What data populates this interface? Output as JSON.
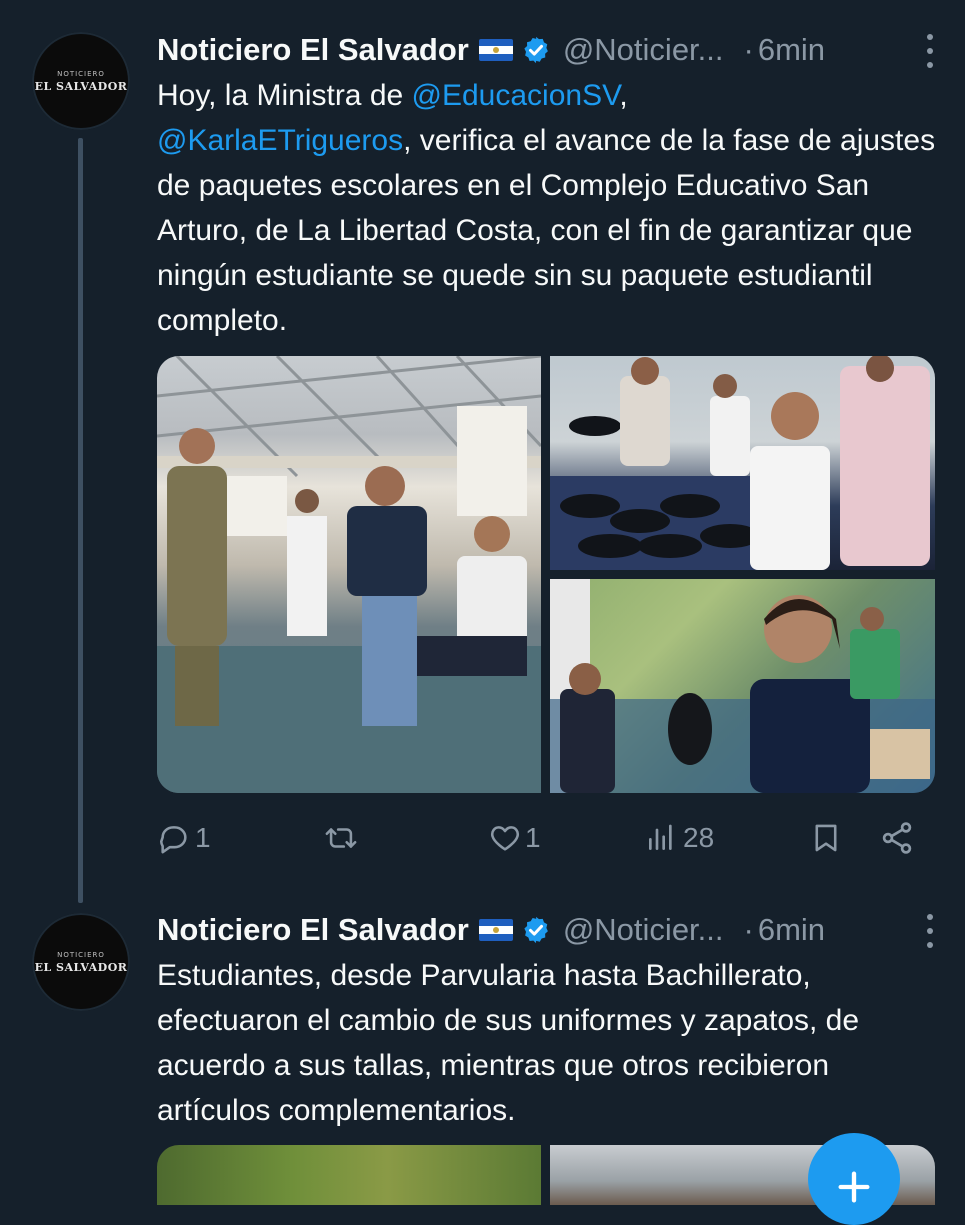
{
  "tweets": [
    {
      "avatar": {
        "line1": "NOTICIERO",
        "line2": "EL SALVADOR"
      },
      "author": "Noticiero El Salvador",
      "handle": "@Noticier...",
      "separator": "·",
      "time": "6min",
      "text_parts": {
        "p1": "Hoy, la Ministra de ",
        "m1": "@EducacionSV",
        "p2": ",",
        "m2": "@KarlaETrigueros",
        "p3": ", verifica el avance de la fase de ajustes de paquetes escolares en el Complejo Educativo San Arturo, de La Libertad Costa, con el fin de garantizar que ningún estudiante se quede sin su paquete estudiantil completo."
      },
      "actions": {
        "replies": "1",
        "retweets": "",
        "likes": "1",
        "views": "28"
      }
    },
    {
      "avatar": {
        "line1": "NOTICIERO",
        "line2": "EL SALVADOR"
      },
      "author": "Noticiero El Salvador",
      "handle": "@Noticier...",
      "separator": "·",
      "time": "6min",
      "text": "Estudiantes, desde Parvularia hasta Bachillerato, efectuaron el cambio de sus uniformes y zapatos, de acuerdo a sus tallas, mientras que otros recibieron artículos complementarios."
    }
  ],
  "colors": {
    "background": "#15202b",
    "accent": "#1d9bf0",
    "muted": "#8b98a5",
    "text": "#f7f9f9"
  },
  "icons": [
    "verified-badge-icon",
    "flag-el-salvador-icon",
    "more-icon",
    "reply-icon",
    "retweet-icon",
    "like-icon",
    "views-icon",
    "bookmark-icon",
    "share-icon",
    "compose-fab-icon"
  ]
}
